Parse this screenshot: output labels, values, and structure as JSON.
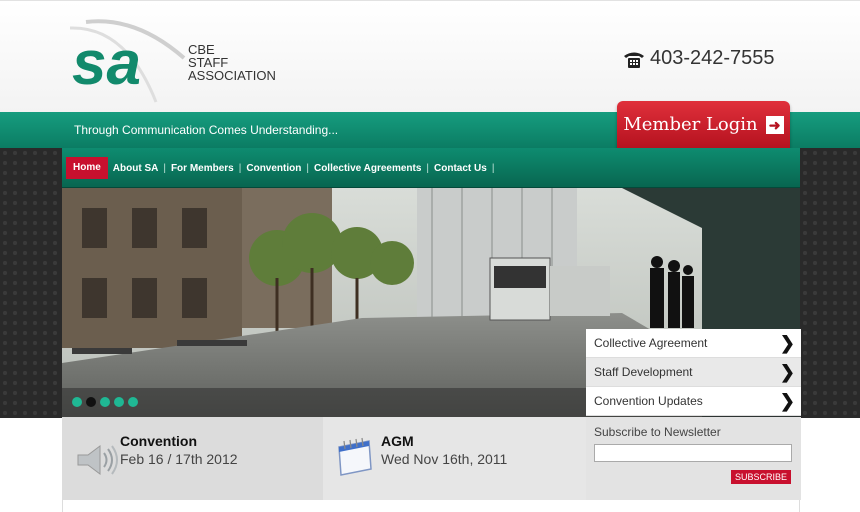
{
  "header": {
    "logo_text": [
      "CBE",
      "STAFF",
      "ASSOCIATION"
    ],
    "phone": "403-242-7555"
  },
  "tagline": "Through Communication Comes Understanding...",
  "member_login": "Member Login",
  "nav": [
    "Home",
    "About SA",
    "For Members",
    "Convention",
    "Collective Agreements",
    "Contact Us"
  ],
  "side_links": [
    "Collective Agreement",
    "Staff Development",
    "Convention Updates"
  ],
  "events": [
    {
      "title": "Convention",
      "date": "Feb 16 / 17th 2012"
    },
    {
      "title": "AGM",
      "date": "Wed Nov 16th, 2011"
    }
  ],
  "newsletter": {
    "label": "Subscribe to Newsletter",
    "button": "SUBSCRIBE"
  },
  "colors": {
    "green": "#0e8c70",
    "red": "#c8102e"
  }
}
